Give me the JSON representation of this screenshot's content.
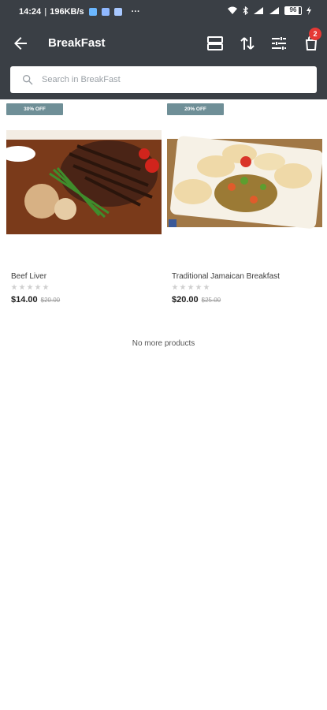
{
  "status": {
    "time": "14:24",
    "speed": "196KB/s",
    "more": "···",
    "battery": "96"
  },
  "appbar": {
    "title": "BreakFast",
    "cart_count": "2"
  },
  "search": {
    "placeholder": "Search in BreakFast"
  },
  "products": [
    {
      "discount": "30% OFF",
      "name": "Beef Liver",
      "price": "$14.00",
      "old_price": "$20.00",
      "rating": 0
    },
    {
      "discount": "20% OFF",
      "name": "Traditional Jamaican Breakfast",
      "price": "$20.00",
      "old_price": "$25.00",
      "rating": 0
    }
  ],
  "footer": {
    "no_more": "No more products"
  },
  "colors": {
    "appbar_bg": "#3a3f45",
    "badge": "#e53935",
    "discount_bg": "#6f8f97"
  }
}
